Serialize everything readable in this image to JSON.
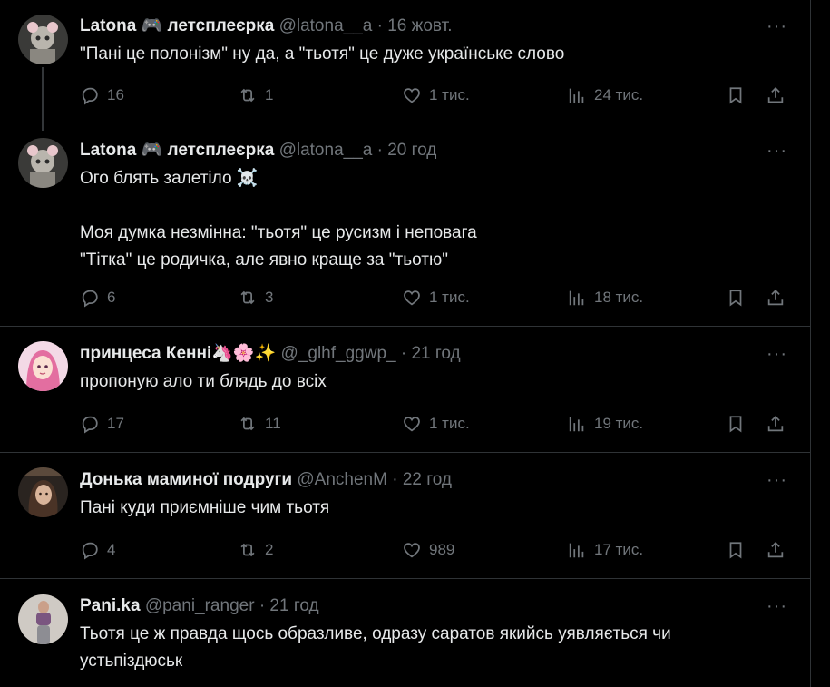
{
  "tweets": [
    {
      "name": "Latona 🎮 летсплеєрка",
      "handle": "@latona__a",
      "time": "16 жовт.",
      "lines": [
        "\"Пані це полонізм\" ну да, а \"тьотя\" це дуже українське слово"
      ],
      "replies": "16",
      "retweets": "1",
      "likes": "1 тис.",
      "views": "24 тис."
    },
    {
      "name": "Latona 🎮 летсплеєрка",
      "handle": "@latona__a",
      "time": "20 год",
      "lines": [
        "Ого блять залетіло ☠️",
        "",
        "Моя думка незмінна: \"тьотя\" це русизм і неповага",
        "\"Тітка\" це родичка, але явно краще за \"тьотю\""
      ],
      "replies": "6",
      "retweets": "3",
      "likes": "1 тис.",
      "views": "18 тис."
    },
    {
      "name": "принцеса Кенні🦄🌸✨",
      "handle": "@_glhf_ggwp_",
      "time": "21 год",
      "lines": [
        "пропоную ало ти блядь до всіх"
      ],
      "replies": "17",
      "retweets": "11",
      "likes": "1 тис.",
      "views": "19 тис."
    },
    {
      "name": "Донька маминої подруги",
      "handle": "@AnchenM",
      "time": "22 год",
      "lines": [
        "Пані куди приємніше чим тьотя"
      ],
      "replies": "4",
      "retweets": "2",
      "likes": "989",
      "views": "17 тис."
    },
    {
      "name": "Pani.ka",
      "handle": "@pani_ranger",
      "time": "21 год",
      "lines": [
        "Тьотя це ж правда щось образливе, одразу саратов якийсь уявляється чи",
        "устьпіздюськ"
      ]
    }
  ],
  "separator": "·",
  "more_label": "···"
}
